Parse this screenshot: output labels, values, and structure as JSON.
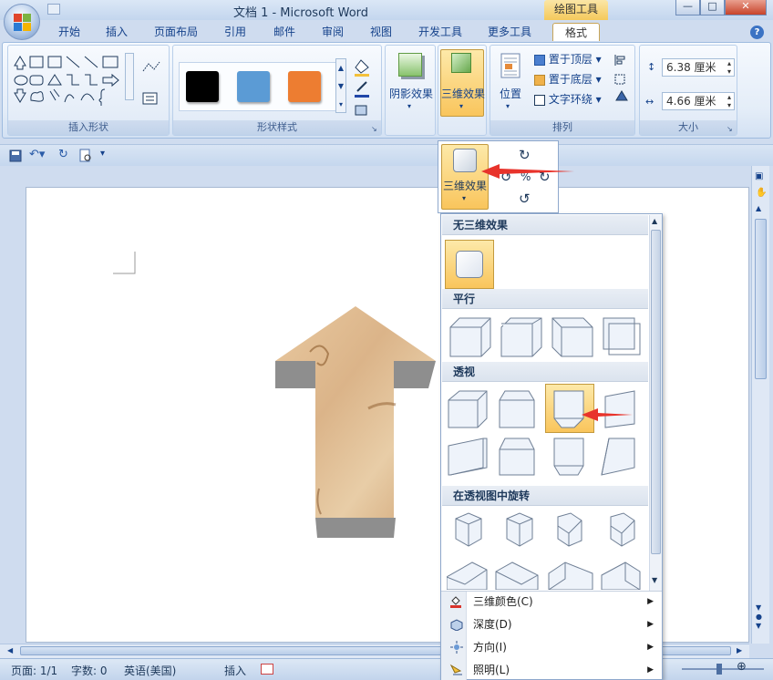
{
  "window": {
    "title": "文档 1 - Microsoft Word",
    "context_title": "绘图工具"
  },
  "tabs": [
    {
      "label": "开始"
    },
    {
      "label": "插入"
    },
    {
      "label": "页面布局"
    },
    {
      "label": "引用"
    },
    {
      "label": "邮件"
    },
    {
      "label": "审阅"
    },
    {
      "label": "视图"
    },
    {
      "label": "开发工具"
    },
    {
      "label": "更多工具"
    },
    {
      "label": "格式"
    }
  ],
  "active_tab": "格式",
  "ribbon": {
    "groups": {
      "insert_shapes": "插入形状",
      "shape_styles": "形状样式",
      "arrange": "排列",
      "size": "大小"
    },
    "style_swatches": [
      "#000000",
      "#5b9bd5",
      "#ed7d31"
    ],
    "shadow_effects": "阴影效果",
    "effects_3d": "三维效果",
    "position": "位置",
    "bring_front": "置于顶层",
    "send_back": "置于底层",
    "text_wrap": "文字环绕",
    "height": "6.38 厘米",
    "width": "4.66 厘米"
  },
  "popup": {
    "label": "三维效果"
  },
  "gallery": {
    "sections": {
      "none": "无三维效果",
      "parallel": "平行",
      "perspective": "透视",
      "rotation": "在透视图中旋转"
    },
    "menu": [
      {
        "label": "三维颜色(C)"
      },
      {
        "label": "深度(D)"
      },
      {
        "label": "方向(I)"
      },
      {
        "label": "照明(L)"
      }
    ]
  },
  "statusbar": {
    "page": "页面: 1/1",
    "words": "字数: 0",
    "language": "英语(美国)",
    "mode": "插入"
  },
  "colors": {
    "accent_arrow": "#e8332b",
    "selected": "#f9c55c"
  }
}
